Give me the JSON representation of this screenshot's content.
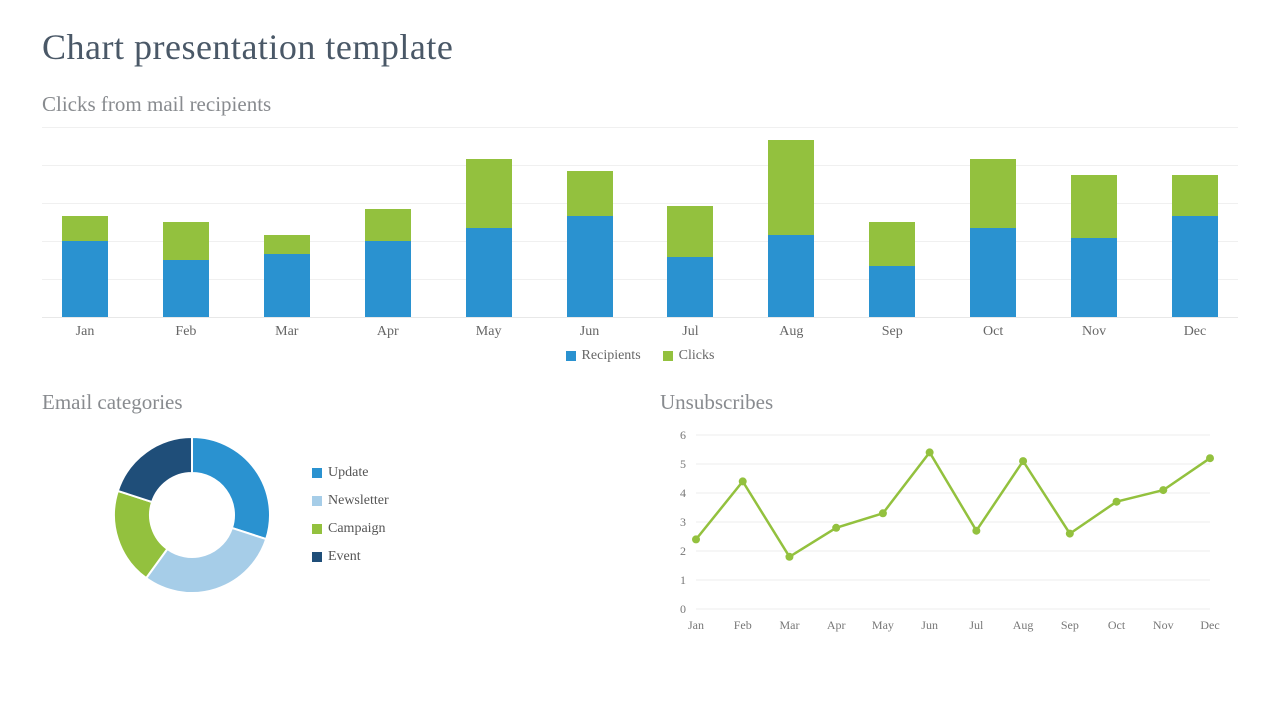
{
  "title": "Chart presentation template",
  "chart_data": [
    {
      "id": "clicks",
      "type": "bar",
      "title": "Clicks from mail recipients",
      "categories": [
        "Jan",
        "Feb",
        "Mar",
        "Apr",
        "May",
        "Jun",
        "Jul",
        "Aug",
        "Sep",
        "Oct",
        "Nov",
        "Dec"
      ],
      "series": [
        {
          "name": "Recipients",
          "color": "#2a92d0",
          "values": [
            2.4,
            1.8,
            2.0,
            2.4,
            2.8,
            3.2,
            1.9,
            2.6,
            1.6,
            2.8,
            2.5,
            3.2
          ]
        },
        {
          "name": "Clicks",
          "color": "#93c13e",
          "values": [
            0.8,
            1.2,
            0.6,
            1.0,
            2.2,
            1.4,
            1.6,
            3.0,
            1.4,
            2.2,
            2.0,
            1.3
          ]
        }
      ],
      "ylim": [
        0,
        6
      ],
      "xlabel": "",
      "ylabel": ""
    },
    {
      "id": "categories",
      "type": "pie",
      "title": "Email categories",
      "series": [
        {
          "name": "Update",
          "color": "#2a92d0",
          "value": 30
        },
        {
          "name": "Newsletter",
          "color": "#a6cde8",
          "value": 30
        },
        {
          "name": "Campaign",
          "color": "#93c13e",
          "value": 20
        },
        {
          "name": "Event",
          "color": "#1f4e79",
          "value": 20
        }
      ]
    },
    {
      "id": "unsub",
      "type": "line",
      "title": "Unsubscribes",
      "categories": [
        "Jan",
        "Feb",
        "Mar",
        "Apr",
        "May",
        "Jun",
        "Jul",
        "Aug",
        "Sep",
        "Oct",
        "Nov",
        "Dec"
      ],
      "series": [
        {
          "name": "Unsubscribes",
          "color": "#93c13e",
          "values": [
            2.4,
            4.4,
            1.8,
            2.8,
            3.3,
            5.4,
            2.7,
            5.1,
            2.6,
            3.7,
            4.1,
            5.2
          ]
        }
      ],
      "ylim": [
        0,
        6
      ],
      "yticks": [
        0,
        1,
        2,
        3,
        4,
        5,
        6
      ],
      "xlabel": "",
      "ylabel": ""
    }
  ]
}
